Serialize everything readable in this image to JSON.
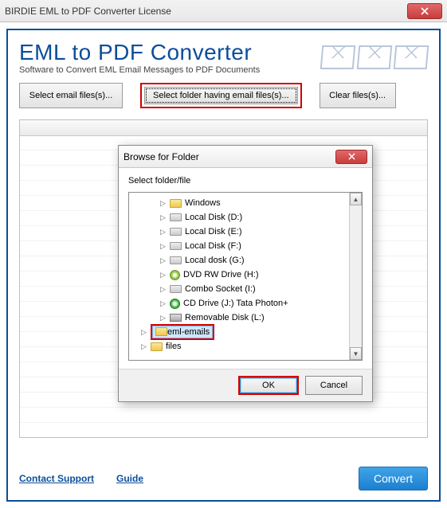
{
  "window": {
    "title": "BIRDIE EML to PDF Converter License"
  },
  "header": {
    "title": "EML to PDF Converter",
    "subtitle": "Software to Convert EML Email Messages to PDF Documents"
  },
  "toolbar": {
    "select_files": "Select email files(s)...",
    "select_folder": "Select folder having email files(s)...",
    "clear": "Clear files(s)..."
  },
  "footer": {
    "contact": "Contact Support",
    "guide": "Guide",
    "convert": "Convert"
  },
  "dialog": {
    "title": "Browse for Folder",
    "label": "Select folder/file",
    "ok": "OK",
    "cancel": "Cancel",
    "tree": [
      {
        "icon": "folder",
        "label": "Windows",
        "indent": 2,
        "expand": "closed"
      },
      {
        "icon": "drive",
        "label": "Local Disk (D:)",
        "indent": 2,
        "expand": "closed"
      },
      {
        "icon": "drive",
        "label": "Local Disk (E:)",
        "indent": 2,
        "expand": "closed"
      },
      {
        "icon": "drive",
        "label": "Local Disk (F:)",
        "indent": 2,
        "expand": "closed"
      },
      {
        "icon": "drive",
        "label": "Local dosk  (G:)",
        "indent": 2,
        "expand": "closed"
      },
      {
        "icon": "dvd",
        "label": "DVD RW Drive (H:)",
        "indent": 2,
        "expand": "closed"
      },
      {
        "icon": "drive",
        "label": "Combo Socket (I:)",
        "indent": 2,
        "expand": "closed"
      },
      {
        "icon": "cd",
        "label": "CD Drive (J:) Tata Photon+",
        "indent": 2,
        "expand": "closed"
      },
      {
        "icon": "remov",
        "label": "Removable Disk (L:)",
        "indent": 2,
        "expand": "closed"
      },
      {
        "icon": "folder",
        "label": "eml-emails",
        "indent": 1,
        "expand": "closed",
        "selected": true
      },
      {
        "icon": "folder",
        "label": "files",
        "indent": 1,
        "expand": "closed"
      }
    ]
  }
}
